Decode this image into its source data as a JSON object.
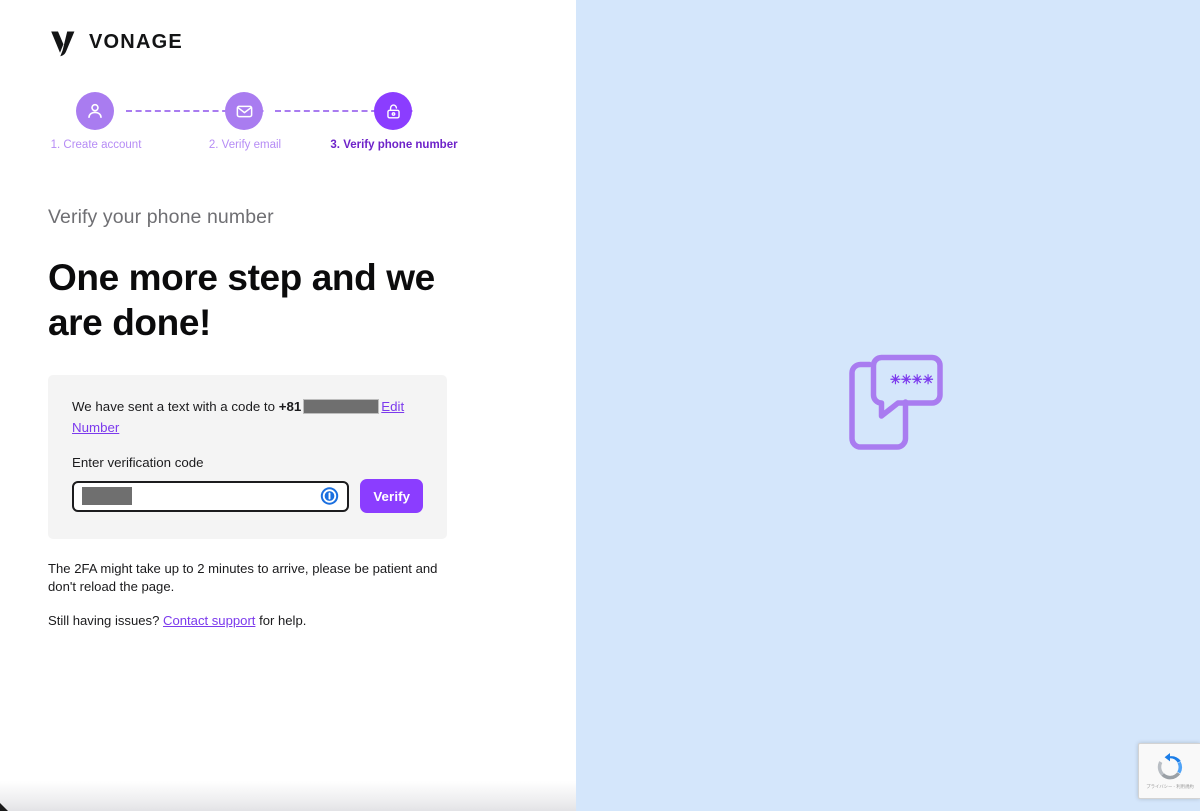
{
  "brand": {
    "name": "VONAGE",
    "logo_icon": "vonage-v-logo",
    "accent_color": "#8b3dff",
    "accent_light": "#a97cf0",
    "step_label_color": "#b68cf5"
  },
  "stepper": {
    "steps": [
      {
        "label": "1. Create account",
        "icon": "person-icon",
        "state": "complete"
      },
      {
        "label": "2. Verify email",
        "icon": "envelope-icon",
        "state": "complete"
      },
      {
        "label": "3. Verify phone number",
        "icon": "unlocked-padlock-icon",
        "state": "current"
      }
    ]
  },
  "main": {
    "eyebrow": "Verify your phone number",
    "headline": "One more step and we are done!"
  },
  "card": {
    "sent_prefix": "We have sent a text with a code to ",
    "country_code": "+81",
    "phone_redacted": "",
    "edit_link": "Edit Number",
    "field_label": "Enter verification code",
    "code_value": "",
    "code_placeholder": "",
    "password_manager_icon": "1password-icon",
    "verify_button": "Verify"
  },
  "notes": {
    "patience": "The 2FA might take up to 2 minutes to arrive, please be patient and don't reload the page.",
    "support_prefix": "Still having issues? ",
    "support_link": "Contact support",
    "support_suffix": " for help."
  },
  "illustration": {
    "icon": "phone-with-sms-bubble-icon",
    "bubble_code": "✳✳✳✳",
    "stroke_color": "#a97cf0",
    "background_color": "#d4e6fb"
  },
  "recaptcha": {
    "icon": "recaptcha-logo-icon",
    "text": "プライバシー - 利用規約"
  }
}
